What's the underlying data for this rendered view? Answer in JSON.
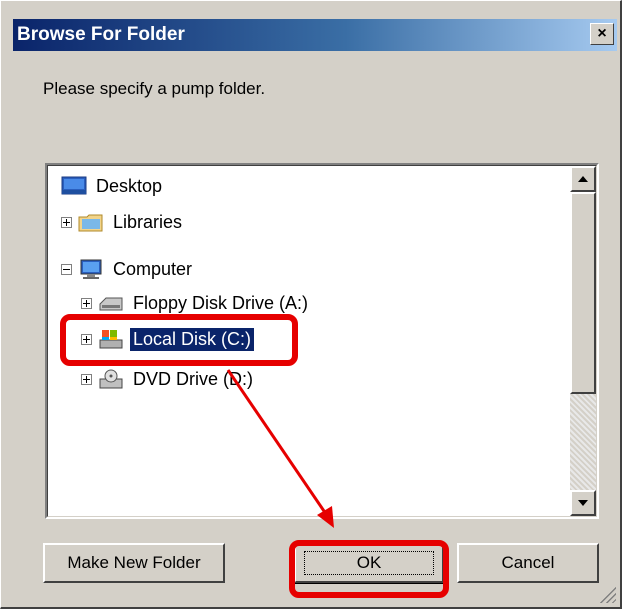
{
  "window": {
    "title": "Browse For Folder",
    "close_glyph": "×"
  },
  "prompt": "Please specify a pump folder.",
  "tree": {
    "items": [
      {
        "label": "Desktop",
        "icon": "desktop-icon"
      },
      {
        "label": "Libraries",
        "icon": "libraries-icon",
        "expander": "+"
      },
      {
        "label": "Computer",
        "icon": "computer-icon",
        "expander": "-"
      },
      {
        "label": "Floppy Disk Drive (A:)",
        "icon": "floppy-drive-icon",
        "expander": "+"
      },
      {
        "label": "Local Disk (C:)",
        "icon": "local-disk-icon",
        "expander": "+",
        "selected": true
      },
      {
        "label": "DVD Drive (D:)",
        "icon": "dvd-drive-icon",
        "expander": "+"
      }
    ]
  },
  "buttons": {
    "make_new_folder": "Make New Folder",
    "ok": "OK",
    "cancel": "Cancel"
  },
  "annotation": {
    "color": "#e60000"
  },
  "colors": {
    "selection": "#0a246a",
    "dialog_bg": "#d4d0c8"
  }
}
